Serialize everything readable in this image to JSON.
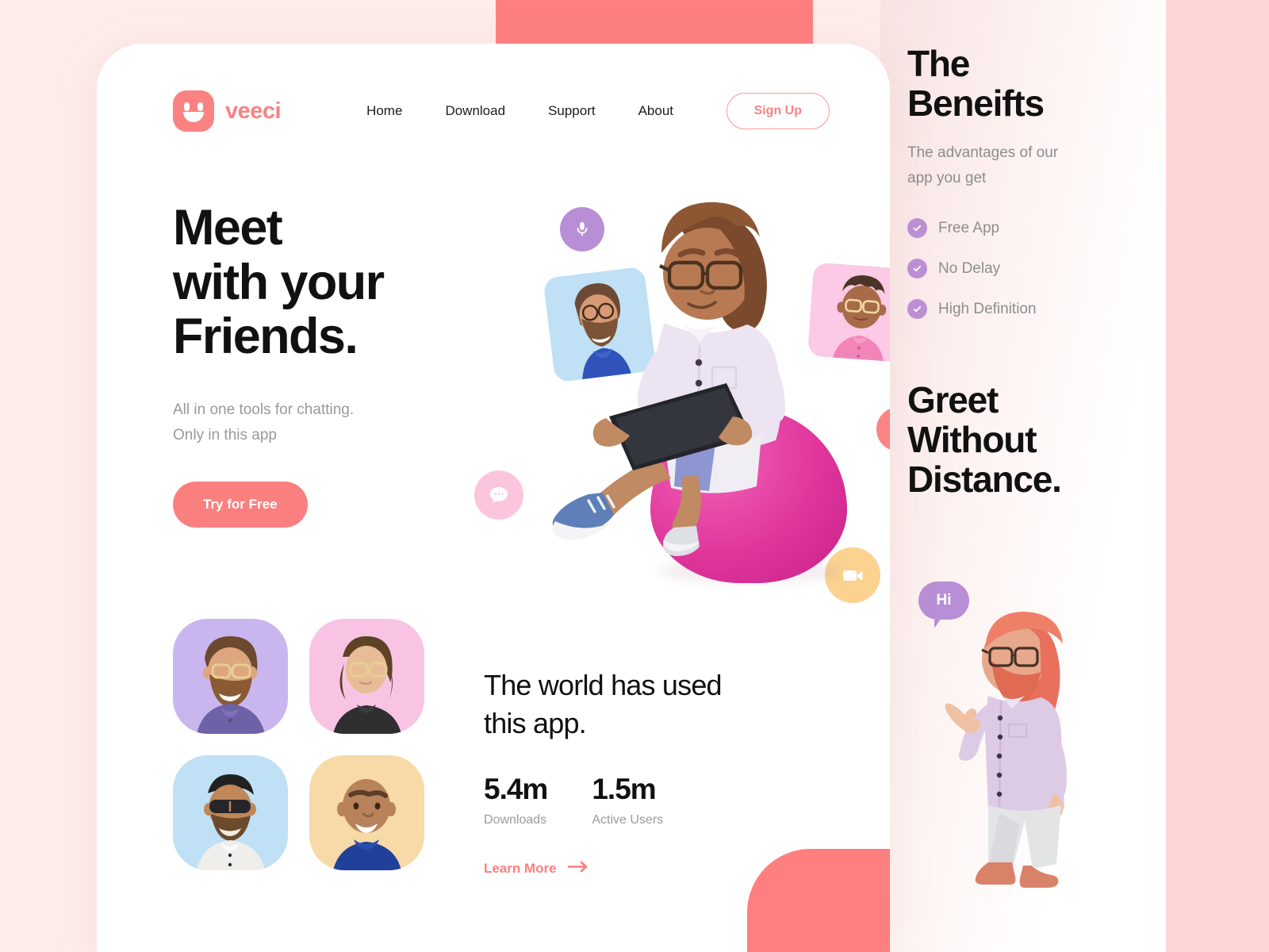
{
  "theme": {
    "page_background": "#fdecea",
    "accent_coral": "#fa7f7f",
    "accent_purple": "#b88fd6",
    "text_dark": "#111111",
    "text_muted": "#999999",
    "card_background": "#ffffff",
    "right_band": "#ffd6d8"
  },
  "nav": {
    "brand_name": "veeci",
    "logo_icon": "smiley-face-icon",
    "links": [
      {
        "label": "Home"
      },
      {
        "label": "Download"
      },
      {
        "label": "Support"
      },
      {
        "label": "About"
      }
    ],
    "signup_label": "Sign Up"
  },
  "hero": {
    "title": "Meet\nwith your\nFriends.",
    "subtitle": "All in one tools for chatting.\nOnly in this app",
    "cta_label": "Try for Free",
    "floating_badges": [
      {
        "icon": "microphone-icon",
        "color": "#b88fd6"
      },
      {
        "icon": "chat-bubble-icon",
        "color": "#fcc5de"
      },
      {
        "icon": "person-icon",
        "color": "#fb8484"
      },
      {
        "icon": "video-camera-icon",
        "color": "#fcd290"
      }
    ],
    "video_cards": [
      {
        "name": "bearded-man-blue-card",
        "color": "#bfe0f5"
      },
      {
        "name": "man-glasses-pink-card",
        "color": "#fcc9e6"
      }
    ],
    "main_illustration": "man-on-beanbag-with-tablet"
  },
  "avatars": [
    {
      "name": "avatar-bearded-glasses",
      "background": "#c9b6ee"
    },
    {
      "name": "avatar-short-hair-glasses",
      "background": "#f9c4e4"
    },
    {
      "name": "avatar-sunglasses-beard",
      "background": "#bfe0f5"
    },
    {
      "name": "avatar-bald-blue-shirt",
      "background": "#f8d9a8"
    }
  ],
  "stats": {
    "title": "The world has used\nthis app.",
    "items": [
      {
        "value": "5.4m",
        "label": "Downloads"
      },
      {
        "value": "1.5m",
        "label": "Active Users"
      }
    ],
    "learn_more_label": "Learn More",
    "learn_more_icon": "arrow-right-icon"
  },
  "sidebar": {
    "benefits_title": "The\nBeneifts",
    "benefits_subtitle": "The advantages of our\napp you get",
    "benefits": [
      {
        "label": "Free App",
        "icon": "check-circle-icon"
      },
      {
        "label": "No Delay",
        "icon": "check-circle-icon"
      },
      {
        "label": "High Definition",
        "icon": "check-circle-icon"
      }
    ],
    "greet_title": "Greet\nWithout\nDistance.",
    "greeting_bubble": "Hi",
    "greeting_illustration": "waving-man-illustration"
  }
}
